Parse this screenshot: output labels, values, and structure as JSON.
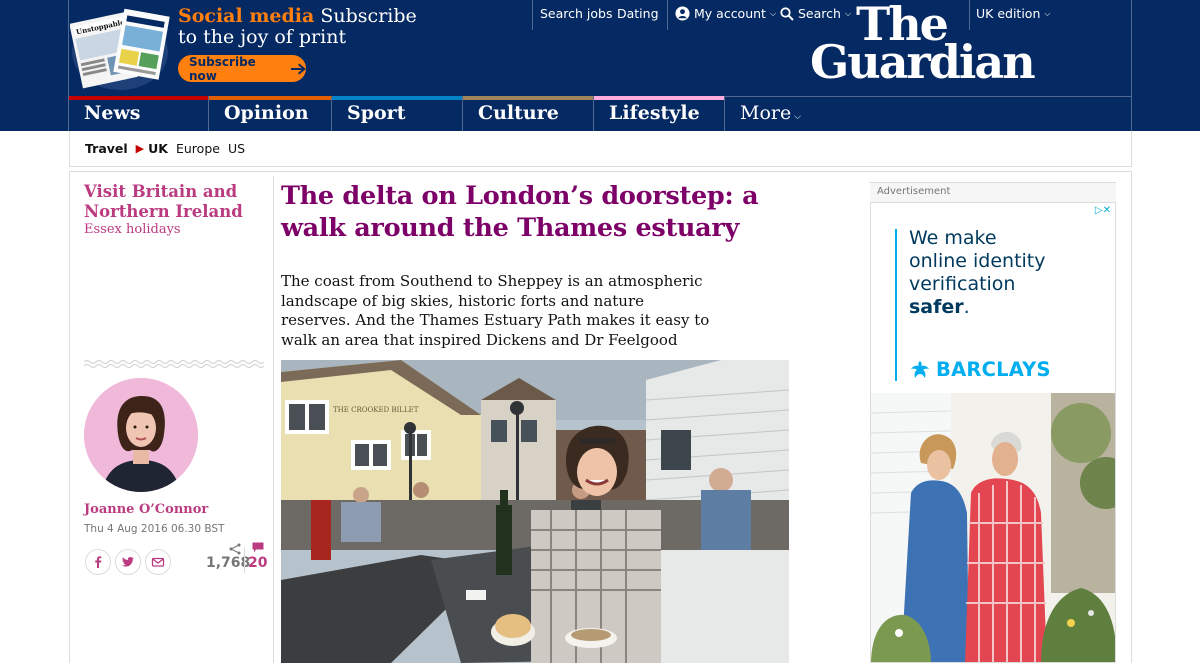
{
  "header": {
    "promo": {
      "title_bold": "Social media",
      "title_rest": " Subscribe",
      "subtitle": "to the joy of print",
      "button_label": "Subscribe now",
      "paper_masthead": "Unstoppable?"
    },
    "top_links": {
      "search_jobs": "Search jobs",
      "dating": "Dating",
      "my_account": "My account",
      "search": "Search",
      "edition": "UK edition"
    },
    "logo": {
      "line1": "The",
      "line2": "Guardian"
    },
    "nav": [
      {
        "label": "News",
        "color": "#c70000"
      },
      {
        "label": "Opinion",
        "color": "#e05e00"
      },
      {
        "label": "Sport",
        "color": "#0084c6"
      },
      {
        "label": "Culture",
        "color": "#a1845c"
      },
      {
        "label": "Lifestyle",
        "color": "#ffabdb",
        "active": true
      },
      {
        "label": "More"
      }
    ]
  },
  "subnav": {
    "section": "Travel",
    "current": "UK",
    "items": [
      "Europe",
      "US"
    ]
  },
  "article": {
    "series_title": "Visit Britain and Northern Ireland",
    "series_sub": "Essex holidays",
    "headline": "The delta on London’s doorstep: a walk around the Thames estuary",
    "standfirst": "The coast from Southend to Sheppey is an atmospheric landscape of big skies, historic forts and nature reserves. And the Thames Estuary Path makes it easy to walk an area that inspired Dickens and Dr Feelgood",
    "author": "Joanne O’Connor",
    "date": "Thu 4 Aug 2016 06.30 BST",
    "share_count": "1,768",
    "comment_count": "20",
    "pub_sign": "THE CROOKED BILLET"
  },
  "ad": {
    "label": "Advertisement",
    "copy_line1": "We make",
    "copy_line2": "online identity",
    "copy_line3": "verification",
    "copy_strong": "safer",
    "copy_end": ".",
    "brand": "BARCLAYS"
  },
  "colors": {
    "brand_blue": "#052962",
    "lifestyle_pink": "#bb3b80",
    "headline_purple": "#7d0068",
    "promo_orange": "#ff7f0f",
    "barclays_blue": "#00aeef"
  }
}
